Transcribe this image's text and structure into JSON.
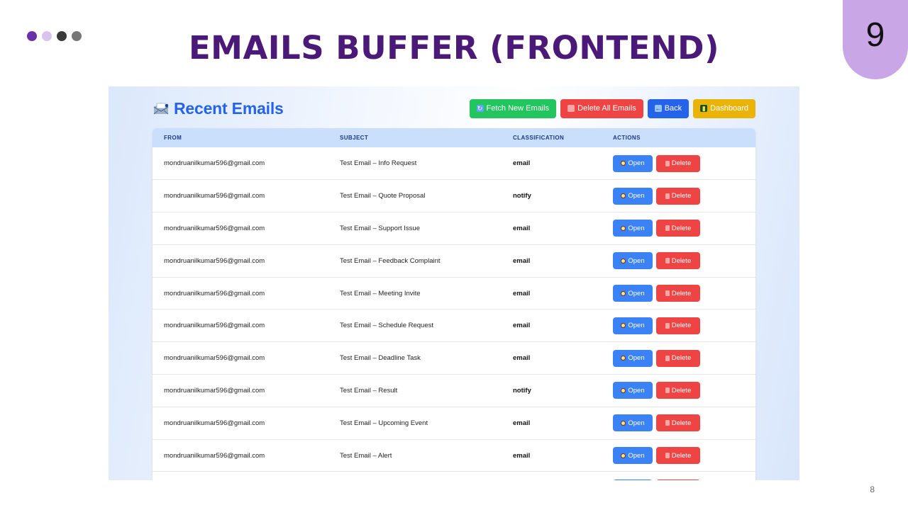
{
  "slide": {
    "title": "EMAILS BUFFER (FRONTEND)",
    "slide_number": "9",
    "footer_page": "8",
    "dot_colors": [
      "#6b2fa8",
      "#d9c4ee",
      "#3a3a3a",
      "#777777"
    ],
    "title_color": "#4b1a78",
    "badge_color": "#c9a6e6"
  },
  "app": {
    "title": "Recent Emails",
    "title_icon": "inbox-tray-icon",
    "toolbar": {
      "fetch": "Fetch New Emails",
      "delete_all": "Delete All Emails",
      "back": "Back",
      "dashboard": "Dashboard"
    },
    "table": {
      "headers": [
        "FROM",
        "SUBJECT",
        "CLASSIFICATION",
        "ACTIONS"
      ],
      "open_label": "Open",
      "delete_label": "Delete",
      "rows": [
        {
          "from": "mondruanilkumar596@gmail.com",
          "subject": "Test Email – Info Request",
          "classification": "email"
        },
        {
          "from": "mondruanilkumar596@gmail.com",
          "subject": "Test Email – Quote Proposal",
          "classification": "notify"
        },
        {
          "from": "mondruanilkumar596@gmail.com",
          "subject": "Test Email – Support Issue",
          "classification": "email"
        },
        {
          "from": "mondruanilkumar596@gmail.com",
          "subject": "Test Email – Feedback Complaint",
          "classification": "email"
        },
        {
          "from": "mondruanilkumar596@gmail.com",
          "subject": "Test Email – Meeting Invite",
          "classification": "email"
        },
        {
          "from": "mondruanilkumar596@gmail.com",
          "subject": "Test Email – Schedule Request",
          "classification": "email"
        },
        {
          "from": "mondruanilkumar596@gmail.com",
          "subject": "Test Email – Deadline Task",
          "classification": "email"
        },
        {
          "from": "mondruanilkumar596@gmail.com",
          "subject": "Test Email – Result",
          "classification": "notify"
        },
        {
          "from": "mondruanilkumar596@gmail.com",
          "subject": "Test Email – Upcoming Event",
          "classification": "email"
        },
        {
          "from": "mondruanilkumar596@gmail.com",
          "subject": "Test Email – Alert",
          "classification": "email"
        }
      ]
    }
  }
}
